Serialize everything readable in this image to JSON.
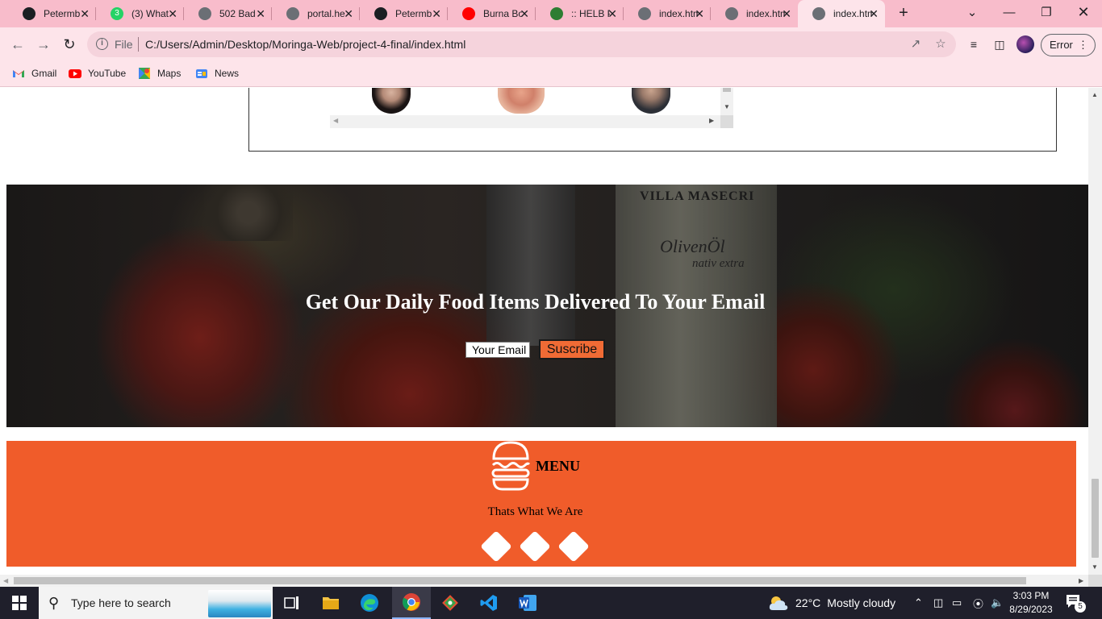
{
  "browser": {
    "tabs": [
      {
        "label": "Petermb",
        "icon": "github-icon",
        "color": "#1b1f23"
      },
      {
        "label": "(3) What",
        "icon": "whatsapp-icon",
        "color": "#25d366",
        "badge": "3"
      },
      {
        "label": "502 Bad",
        "icon": "globe-icon",
        "color": "#6b6f75"
      },
      {
        "label": "portal.he",
        "icon": "globe-icon",
        "color": "#6b6f75"
      },
      {
        "label": "Petermb",
        "icon": "github-icon",
        "color": "#1b1f23"
      },
      {
        "label": "Burna Bo",
        "icon": "youtube-icon",
        "color": "#ff0000"
      },
      {
        "label": ":: HELB P",
        "icon": "helb-icon",
        "color": "#2e7d32"
      },
      {
        "label": "index.htm",
        "icon": "globe-icon",
        "color": "#6b6f75"
      },
      {
        "label": "index.htm",
        "icon": "globe-icon",
        "color": "#6b6f75"
      },
      {
        "label": "index.htm",
        "icon": "globe-icon",
        "color": "#6b6f75",
        "active": true
      }
    ],
    "address": {
      "scheme_label": "File",
      "url": "C:/Users/Admin/Desktop/Moringa-Web/project-4-final/index.html"
    },
    "profile_button": "Error",
    "bookmarks": [
      {
        "label": "Gmail",
        "icon": "gmail-icon"
      },
      {
        "label": "YouTube",
        "icon": "youtube-icon"
      },
      {
        "label": "Maps",
        "icon": "maps-icon"
      },
      {
        "label": "News",
        "icon": "news-icon"
      }
    ]
  },
  "page": {
    "subscribe": {
      "title": "Get Our Daily Food Items Delivered To Your Email",
      "email_placeholder": "Your Email",
      "button_label": "Suscribe",
      "background_text": {
        "brand": "VILLA MASECRI",
        "product": "OlivenÖl",
        "product_sub": "nativ extra"
      }
    },
    "footer": {
      "title": "MENU",
      "tagline": "Thats What We Are",
      "accent_color": "#f05c2a"
    }
  },
  "taskbar": {
    "search_placeholder": "Type here to search",
    "weather": {
      "temp": "22°C",
      "condition": "Mostly cloudy"
    },
    "time": "3:03 PM",
    "date": "8/29/2023",
    "notification_count": "5"
  }
}
